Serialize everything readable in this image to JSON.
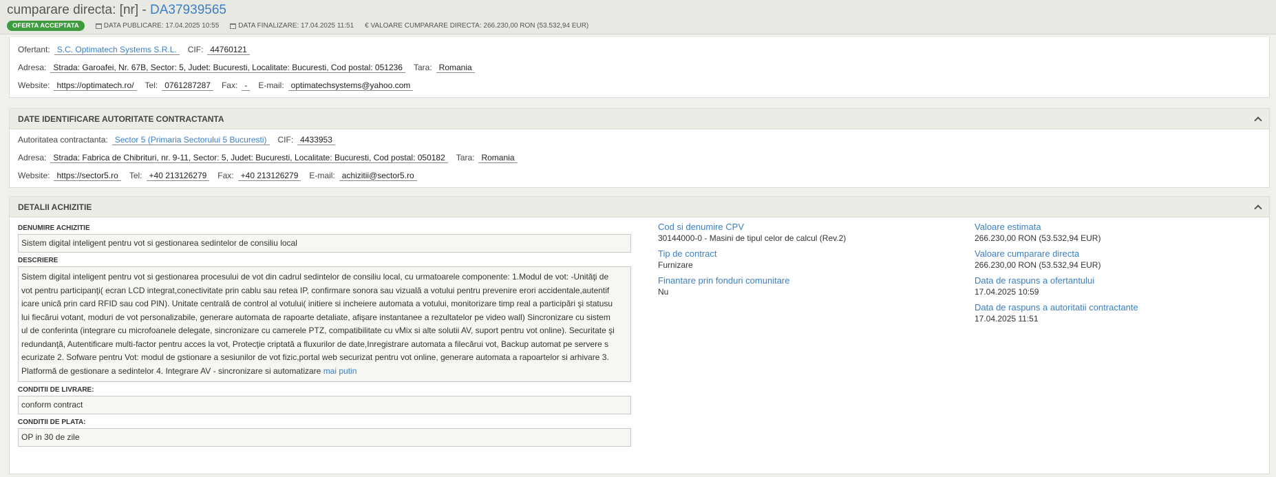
{
  "header": {
    "title_prefix": "cumparare directa: [nr] -",
    "title_number": "DA37939565",
    "status_badge": "OFERTA ACCEPTATA",
    "publish_date": "DATA PUBLICARE: 17.04.2025 10:55",
    "finalize_date": "DATA FINALIZARE: 17.04.2025 11:51",
    "value": "€ VALOARE CUMPARARE DIRECTA: 266.230,00   RON (53.532,94  EUR)"
  },
  "bidder": {
    "ofertant_label": "Ofertant:",
    "ofertant_value": "S.C. Optimatech Systems S.R.L.",
    "cif_label": "CIF:",
    "cif_value": "44760121",
    "address_label": "Adresa:",
    "address_value": "Strada: Garoafei, Nr. 67B, Sector: 5, Judet: Bucuresti, Localitate: Bucuresti, Cod postal: 051236",
    "country_label": "Tara:",
    "country_value": "Romania",
    "website_label": "Website:",
    "website_value": "https://optimatech.ro/",
    "tel_label": "Tel:",
    "tel_value": "0761287287",
    "fax_label": "Fax:",
    "fax_value": "-",
    "email_label": "E-mail:",
    "email_value": "optimatechsystems@yahoo.com"
  },
  "authority": {
    "header": "DATE IDENTIFICARE AUTORITATE CONTRACTANTA",
    "name_label": "Autoritatea contractanta:",
    "name_value": "Sector 5 (Primaria Sectorului 5 Bucuresti)",
    "cif_label": "CIF:",
    "cif_value": "4433953",
    "address_label": "Adresa:",
    "address_value": "Strada: Fabrica de Chibrituri, nr. 9-11, Sector: 5, Judet: Bucuresti, Localitate: Bucuresti, Cod postal: 050182",
    "country_label": "Tara:",
    "country_value": "Romania",
    "website_label": "Website:",
    "website_value": "https://sector5.ro",
    "tel_label": "Tel:",
    "tel_value": "+40 213126279",
    "fax_label": "Fax:",
    "fax_value": "+40 213126279",
    "email_label": "E-mail:",
    "email_value": "achizitii@sector5.ro"
  },
  "details": {
    "header": "DETALII ACHIZITIE",
    "name_label": "DENUMIRE ACHIZITIE",
    "name_value": "Sistem digital inteligent pentru vot si gestionarea sedintelor de consiliu local",
    "description_label": "DESCRIERE",
    "description_lines": [
      "Sistem digital inteligent pentru vot si gestionarea procesului de vot din cadrul sedintelor de consiliu local, cu urmatoarele componente: 1.Modul de vot: -Unităţi de",
      "vot pentru participanţi( ecran LCD integrat,conectivitate prin cablu sau retea IP, confirmare sonora sau vizuală a votului pentru prevenire erori accidentale,autentif",
      "icare unică prin card RFID sau cod PIN). Unitate centrală de control al votului( initiere si incheiere automata a votului, monitorizare timp real a participări şi statusu",
      "lui fiecărui votant, moduri de vot personalizabile, generare automata de rapoarte detaliate, afişare instantanee a rezultatelor pe video wall) Sincronizare cu sistem",
      "ul de conferinta (integrare cu microfoanele delegate, sincronizare cu camerele PTZ, compatibilitate cu vMix si alte solutii AV, suport pentru vot online). Securitate şi",
      "redundanţă, Autentificare multi-factor pentru acces la vot, Protecţie criptată a fluxurilor de date,Inregistrare automata a filecărui vot, Backup automat pe servere s",
      "ecurizate 2. Sofware pentru Vot: modul de gstionare a sesiunilor de vot fizic,portal web securizat pentru vot online, generare automata a rapoartelor si arhivare 3.",
      "Platformă de gestionare a sedintelor 4. Integrare AV - sincronizare si automatizare"
    ],
    "more_link": "mai putin",
    "delivery_label": "CONDITII DE LIVRARE:",
    "delivery_value": "conform contract",
    "payment_label": "CONDITII DE PLATA:",
    "payment_value": "OP in 30 de zile",
    "cpv_label": "Cod si denumire CPV",
    "cpv_value": "30144000-0 - Masini de tipul celor de calcul (Rev.2)",
    "contract_type_label": "Tip de contract",
    "contract_type_value": "Furnizare",
    "eu_funds_label": "Finantare prin fonduri comunitare",
    "eu_funds_value": "Nu",
    "est_value_label": "Valoare estimata",
    "est_value_value": "266.230,00  RON (53.532,94  EUR)",
    "direct_value_label": "Valoare cumparare directa",
    "direct_value_value": "266.230,00  RON (53.532,94  EUR)",
    "bidder_reply_label": "Data de raspuns a ofertantului",
    "bidder_reply_value": "17.04.2025 10:59",
    "authority_reply_label": "Data de raspuns a autoritatii contractante",
    "authority_reply_value": "17.04.2025 11:51"
  }
}
